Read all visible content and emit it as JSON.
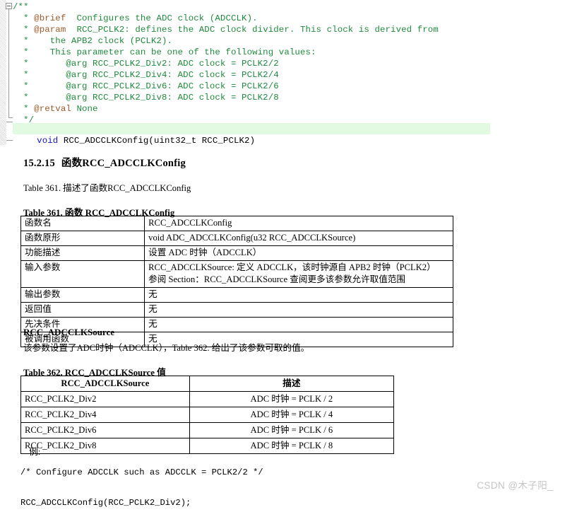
{
  "code_block": {
    "fold_state": "expanded",
    "comment_color": "#1f8b3d",
    "doc_tag_color": "#9c5a2a",
    "keyword_color": "#1414c8",
    "highlight_color": "#e2fae2",
    "lines": [
      {
        "indent": "",
        "tag": "",
        "rest": "/**",
        "cls": "cm"
      },
      {
        "indent": "  * ",
        "tag": "@brief",
        "rest": "  Configures the ADC clock (ADCCLK).",
        "cls": "cm"
      },
      {
        "indent": "  * ",
        "tag": "@param",
        "rest": "  RCC_PCLK2: defines the ADC clock divider. This clock is derived from",
        "cls": "cm"
      },
      {
        "indent": "  * ",
        "tag": "",
        "rest": "   the APB2 clock (PCLK2).",
        "cls": "cm"
      },
      {
        "indent": "  * ",
        "tag": "",
        "rest": "   This parameter can be one of the following values:",
        "cls": "cm"
      },
      {
        "indent": "  * ",
        "tag": "",
        "rest": "      @arg RCC_PCLK2_Div2: ADC clock = PCLK2/2",
        "cls": "cm"
      },
      {
        "indent": "  * ",
        "tag": "",
        "rest": "      @arg RCC_PCLK2_Div4: ADC clock = PCLK2/4",
        "cls": "cm"
      },
      {
        "indent": "  * ",
        "tag": "",
        "rest": "      @arg RCC_PCLK2_Div6: ADC clock = PCLK2/6",
        "cls": "cm"
      },
      {
        "indent": "  * ",
        "tag": "",
        "rest": "      @arg RCC_PCLK2_Div8: ADC clock = PCLK2/8",
        "cls": "cm"
      },
      {
        "indent": "  * ",
        "tag": "@retval",
        "rest": " None",
        "cls": "cm"
      },
      {
        "indent": "  ",
        "tag": "",
        "rest": "*/",
        "cls": "cm"
      }
    ],
    "signature": {
      "keyword": "void",
      "rest": " RCC_ADCCLKConfig(uint32_t RCC_PCLK2)"
    }
  },
  "document": {
    "section_heading": {
      "number": "15.2.15",
      "text": "函数RCC_ADCCLKConfig"
    },
    "caption": "Table 361. 描述了函数RCC_ADCCLKConfig",
    "table_361": {
      "title": "Table 361. 函数 RCC_ADCCLKConfig",
      "rows": [
        {
          "key": "函数名",
          "value": "RCC_ADCCLKConfig"
        },
        {
          "key": "函数原形",
          "value": "void ADC_ADCCLKConfig(u32 RCC_ADCCLKSource)"
        },
        {
          "key": "功能描述",
          "value": "设置 ADC 时钟（ADCCLK）"
        },
        {
          "key": "输入参数",
          "value": "RCC_ADCCLKSource: 定义 ADCCLK，该时钟源自 APB2 时钟（PCLK2）\n参阅 Section：RCC_ADCCLKSource 查阅更多该参数允许取值范围"
        },
        {
          "key": "输出参数",
          "value": "无"
        },
        {
          "key": "返回值",
          "value": "无"
        },
        {
          "key": "先决条件",
          "value": "无"
        },
        {
          "key": "被调用函数",
          "value": "无"
        }
      ]
    },
    "sub_heading": "RCC_ADCCLKSource",
    "sub_paragraph": "该参数设置了ADC时钟（ADCCLK），Table 362. 给出了该参数可取的值。",
    "table_362": {
      "title": "Table 362. RCC_ADCCLKSource 值",
      "headers": [
        "RCC_ADCCLKSource",
        "描述"
      ],
      "rows": [
        {
          "source": "RCC_PCLK2_Div2",
          "desc": "ADC 时钟 = PCLK / 2"
        },
        {
          "source": "RCC_PCLK2_Div4",
          "desc": "ADC 时钟 = PCLK / 4"
        },
        {
          "source": "RCC_PCLK2_Div6",
          "desc": "ADC 时钟 = PCLK / 6"
        },
        {
          "source": "RCC_PCLK2_Div8",
          "desc": "ADC 时钟 = PCLK / 8"
        }
      ]
    },
    "example": {
      "label": "例:",
      "line1": "/* Configure ADCCLK such as ADCCLK = PCLK2/2 */",
      "line2": "RCC_ADCCLKConfig(RCC_PCLK2_Div2);"
    }
  },
  "watermark": {
    "text": "CSDN @木子阳_",
    "color": "#c4c4c4"
  }
}
